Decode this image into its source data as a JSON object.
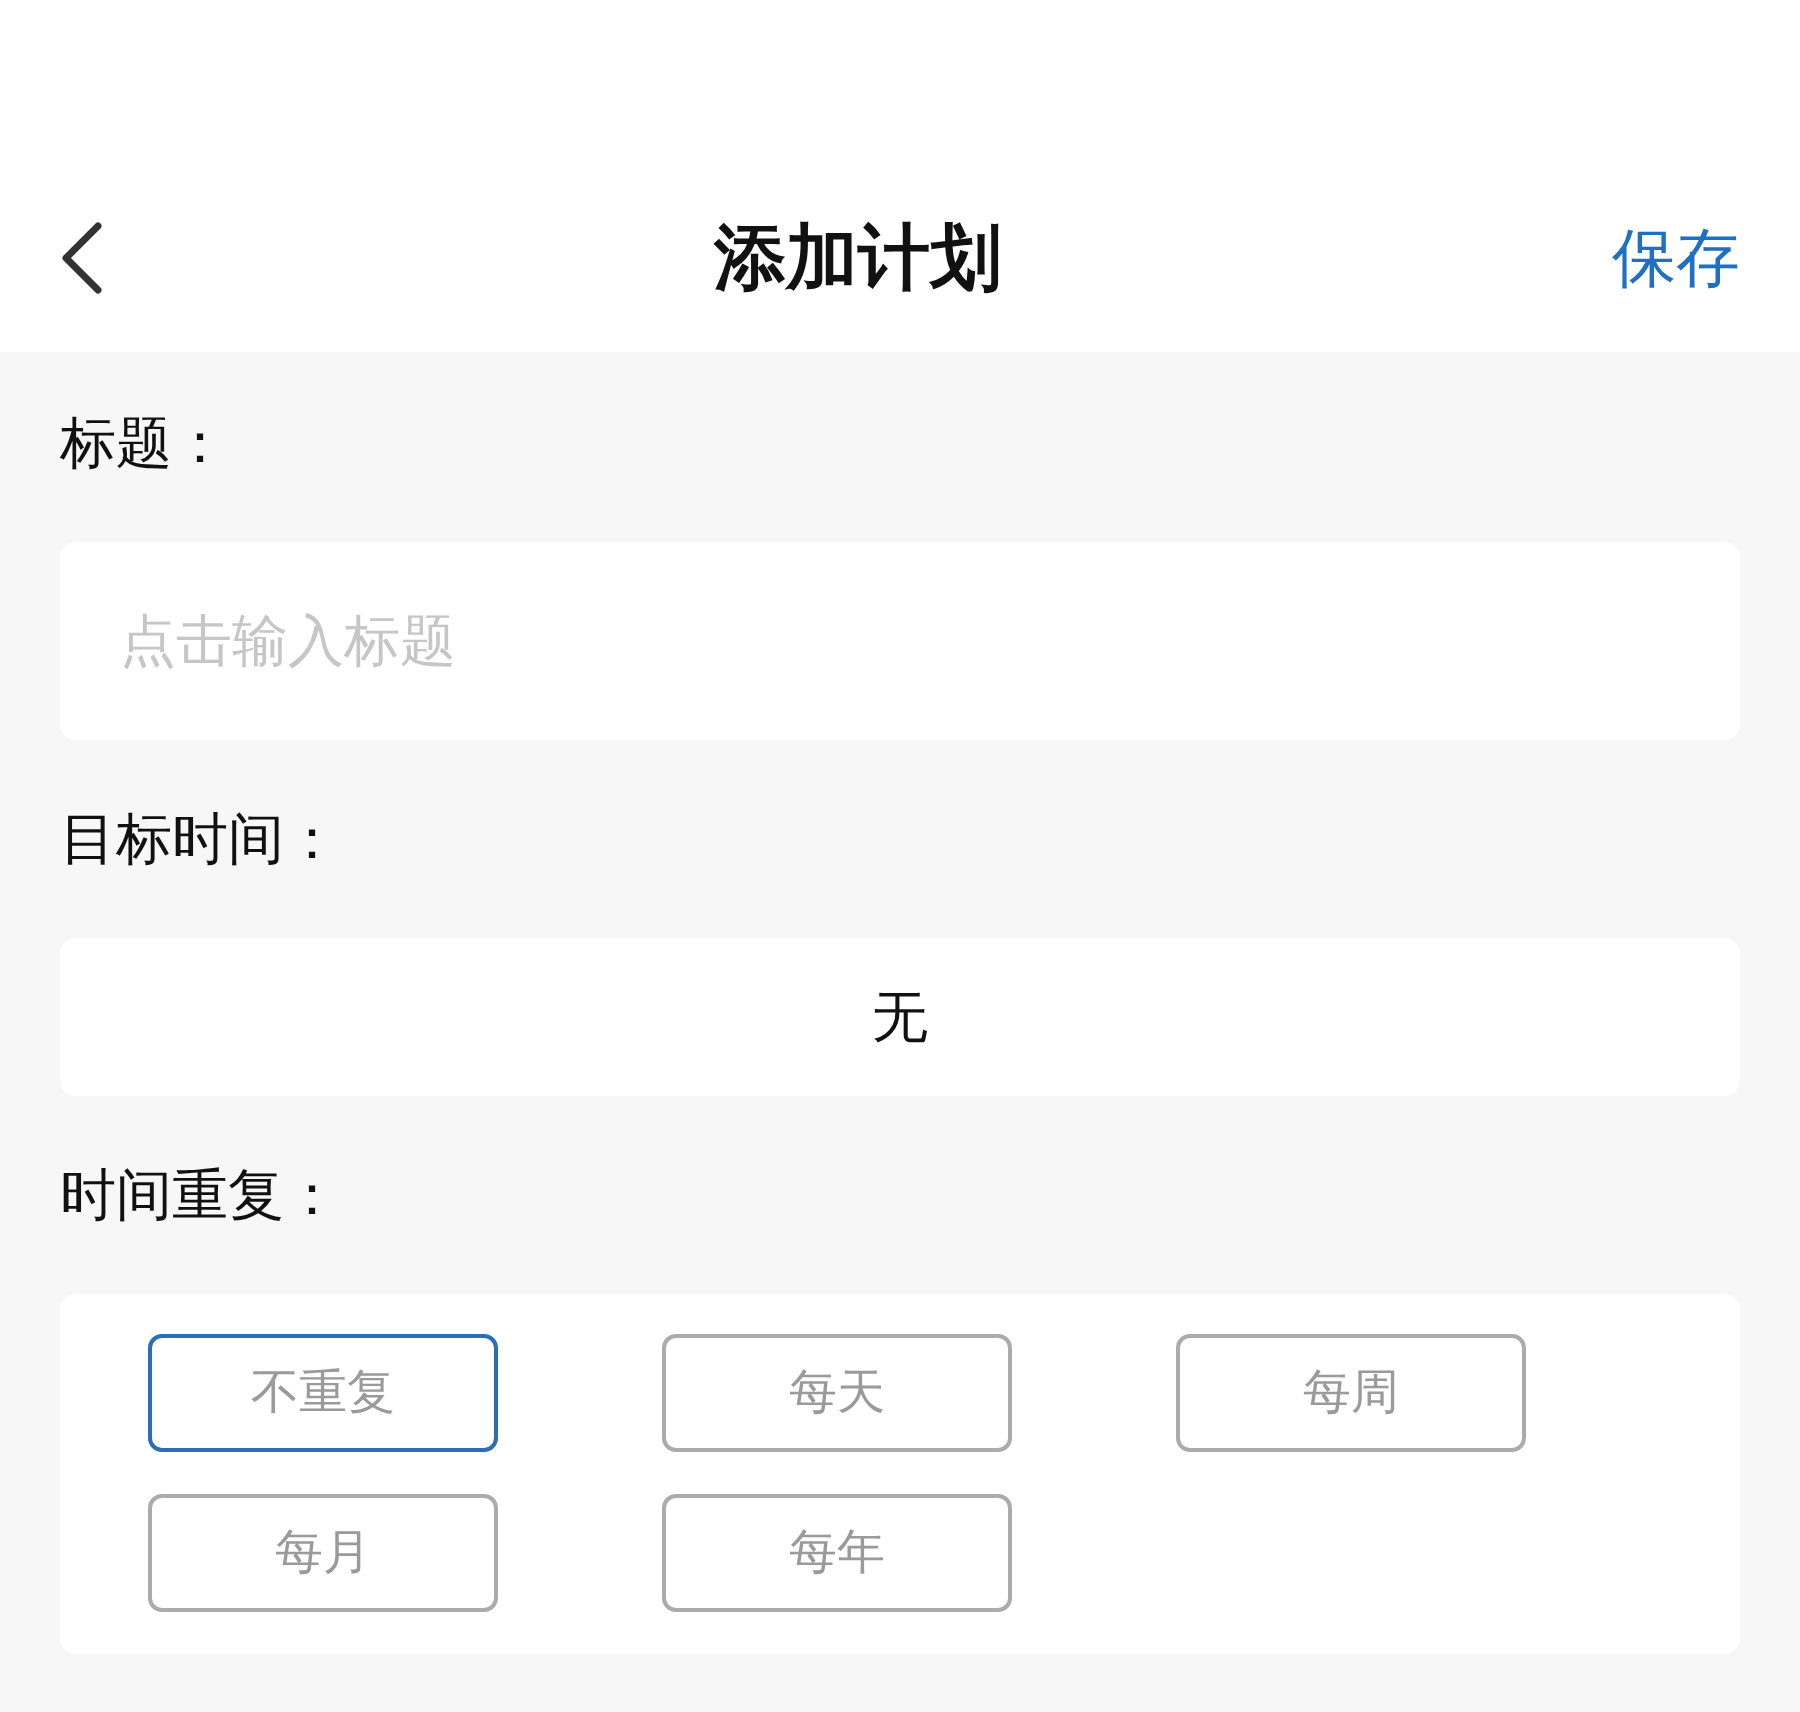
{
  "header": {
    "title": "添加计划",
    "action": "保存"
  },
  "fields": [
    {
      "kind": "input",
      "label": "标题：",
      "placeholder": "点击输入标题"
    },
    {
      "kind": "picker",
      "label": "目标时间：",
      "value": "无"
    }
  ],
  "repeat": {
    "label": "时间重复：",
    "options": [
      {
        "label": "不重复",
        "selected": true
      },
      {
        "label": "每天",
        "selected": false
      },
      {
        "label": "每周",
        "selected": false
      },
      {
        "label": "每月",
        "selected": false
      },
      {
        "label": "每年",
        "selected": false
      }
    ]
  }
}
